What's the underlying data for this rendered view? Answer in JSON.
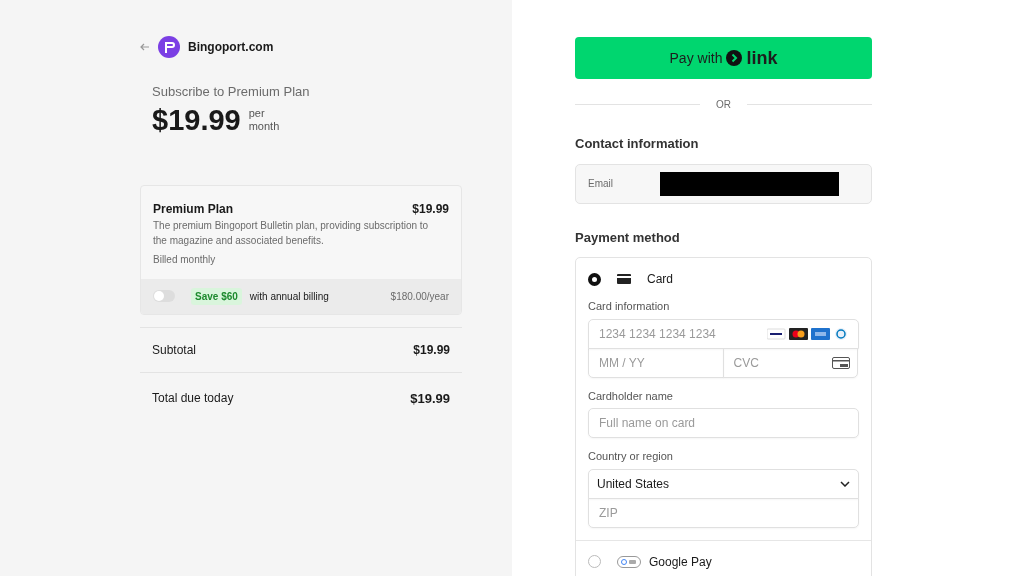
{
  "merchant": {
    "name": "Bingoport.com"
  },
  "summary": {
    "title": "Subscribe to Premium Plan",
    "price": "$19.99",
    "period_top": "per",
    "period_bottom": "month"
  },
  "plan": {
    "name": "Premium Plan",
    "price": "$19.99",
    "description": "The premium Bingoport Bulletin plan, providing subscription to the magazine and associated benefits.",
    "billing": "Billed monthly"
  },
  "annual": {
    "on": false,
    "badge": "Save $60",
    "label": "with annual billing",
    "price": "$180.00/year"
  },
  "totals": [
    {
      "label": "Subtotal",
      "value": "$19.99",
      "kind": "subtotal"
    },
    {
      "label": "Total due today",
      "value": "$19.99",
      "kind": "total"
    }
  ],
  "link_button": {
    "label": "Pay with",
    "brand": "link"
  },
  "divider": "OR",
  "contact": {
    "heading": "Contact information",
    "email_label": "Email",
    "redacted": true
  },
  "payment": {
    "heading": "Payment method",
    "methods": [
      {
        "label": "Card",
        "kind": "card",
        "selected": true
      },
      {
        "label": "Google Pay",
        "kind": "gpay",
        "selected": false
      }
    ]
  },
  "card_form": {
    "info_label": "Card information",
    "number_placeholder": "1234 1234 1234 1234",
    "expiry_placeholder": "MM / YY",
    "cvc_placeholder": "CVC",
    "name_label": "Cardholder name",
    "name_placeholder": "Full name on card",
    "country_label": "Country or region",
    "country": "United States",
    "zip_placeholder": "ZIP"
  }
}
